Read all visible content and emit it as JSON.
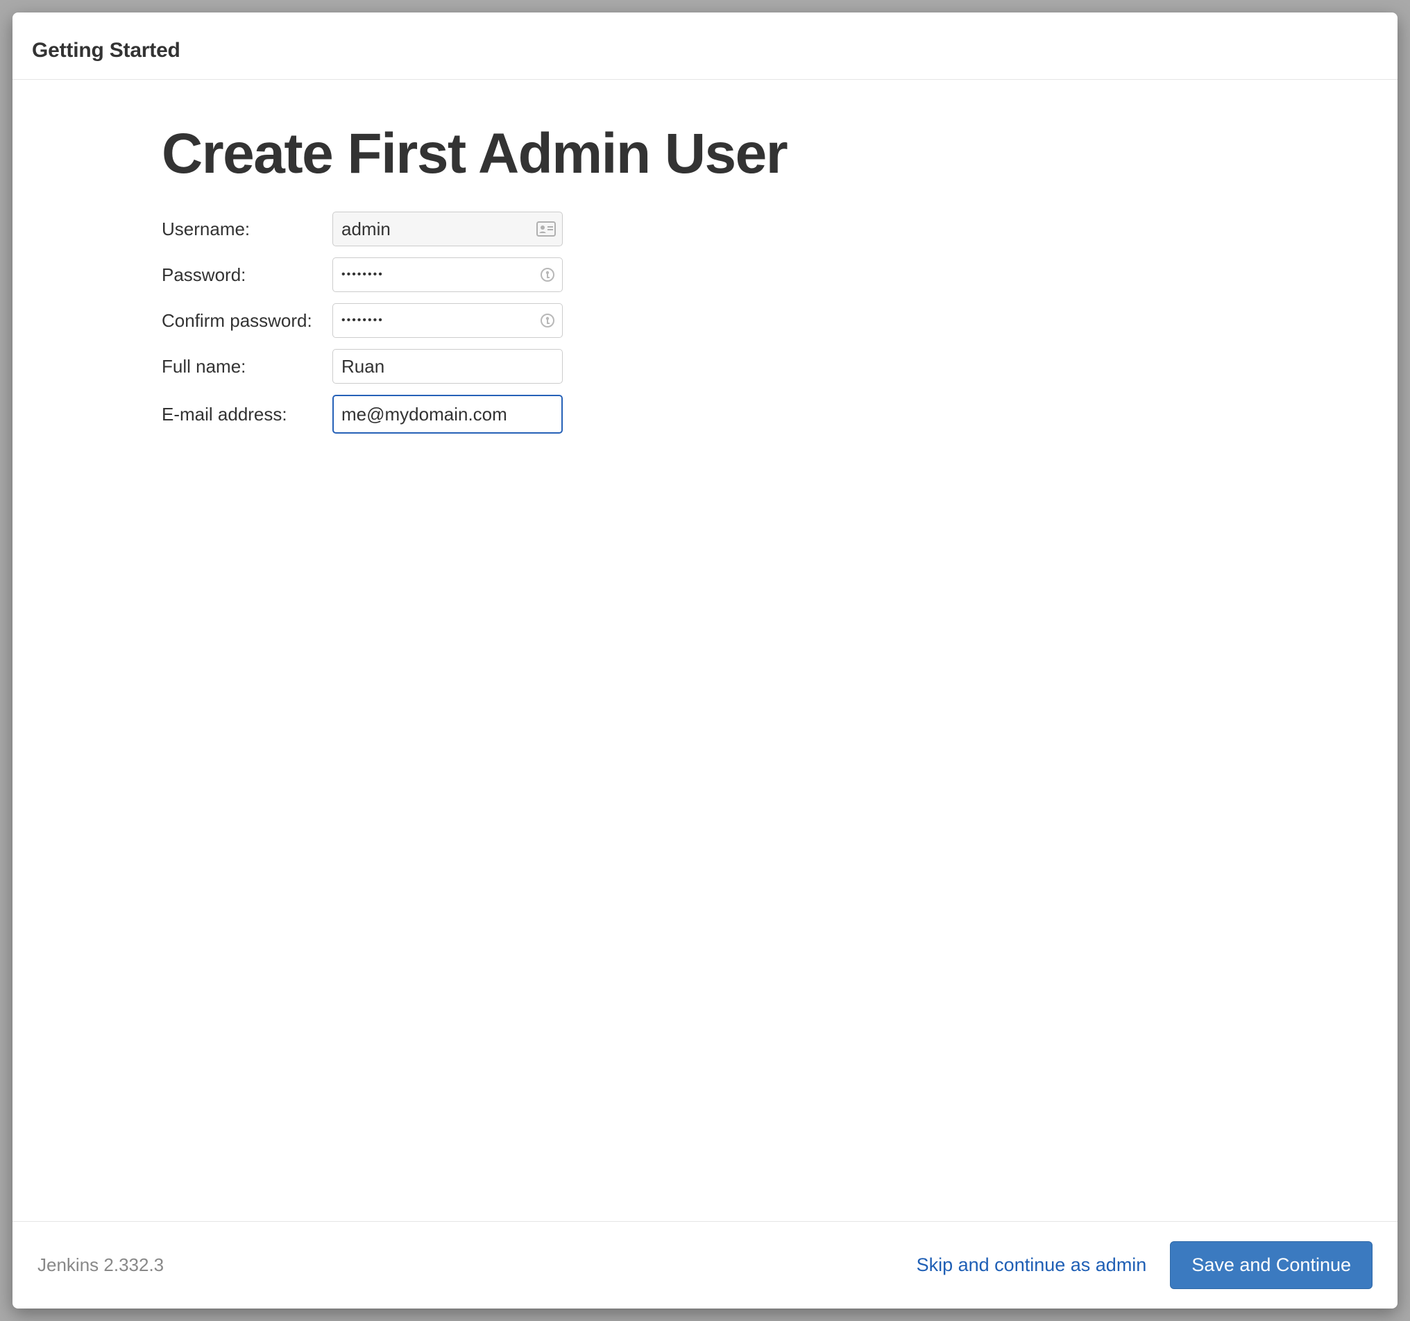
{
  "header": {
    "title": "Getting Started"
  },
  "page": {
    "title": "Create First Admin User"
  },
  "form": {
    "username": {
      "label": "Username:",
      "value": "admin"
    },
    "password": {
      "label": "Password:",
      "value": "••••••••"
    },
    "confirm_password": {
      "label": "Confirm password:",
      "value": "••••••••"
    },
    "full_name": {
      "label": "Full name:",
      "value": "Ruan"
    },
    "email": {
      "label": "E-mail address:",
      "value": "me@mydomain.com"
    }
  },
  "footer": {
    "version": "Jenkins 2.332.3",
    "skip_label": "Skip and continue as admin",
    "save_label": "Save and Continue"
  }
}
